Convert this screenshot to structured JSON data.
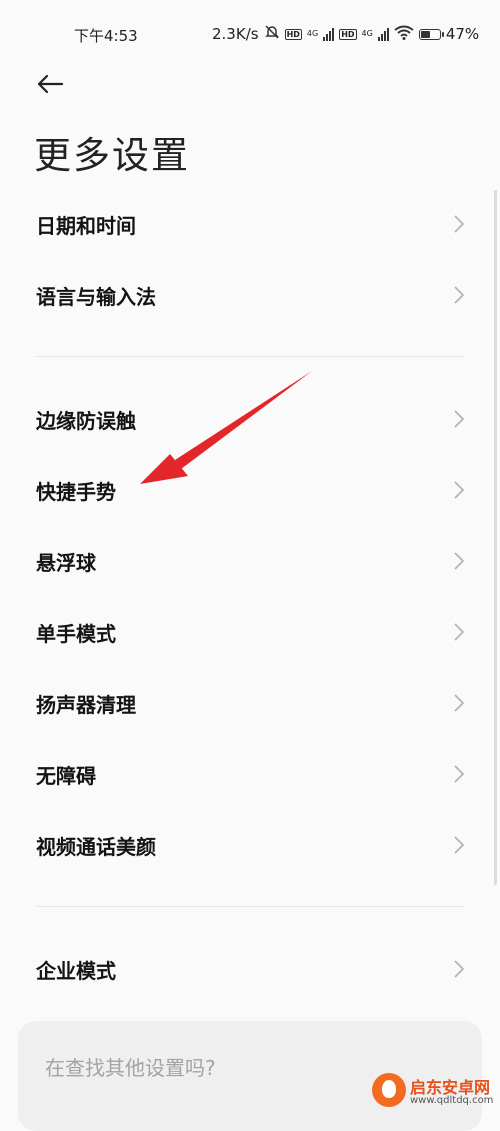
{
  "status_bar": {
    "time": "下午4:53",
    "speed": "2.3K/s",
    "network_1": "4G",
    "network_2": "4G",
    "hd_label": "HD",
    "battery": "47%",
    "battery_level": 0.47
  },
  "header": {
    "back_icon": "arrow-left-icon",
    "title": "更多设置"
  },
  "sections": [
    {
      "items": [
        {
          "label": "日期和时间"
        },
        {
          "label": "语言与输入法"
        }
      ]
    },
    {
      "items": [
        {
          "label": "边缘防误触"
        },
        {
          "label": "快捷手势"
        },
        {
          "label": "悬浮球"
        },
        {
          "label": "单手模式"
        },
        {
          "label": "扬声器清理"
        },
        {
          "label": "无障碍"
        },
        {
          "label": "视频通话美颜"
        }
      ]
    },
    {
      "items": [
        {
          "label": "企业模式"
        }
      ]
    }
  ],
  "search_card": {
    "text": "在查找其他设置吗?"
  },
  "annotation": {
    "type": "red-arrow",
    "color": "#e3262a",
    "points_to": "快捷手势"
  },
  "watermark": {
    "title": "启东安卓网",
    "url": "www.qdltdq.com"
  },
  "colors": {
    "background": "#fafafa",
    "chevron": "#b0b0b0",
    "divider": "#e6e6e6",
    "card": "#efefef"
  }
}
